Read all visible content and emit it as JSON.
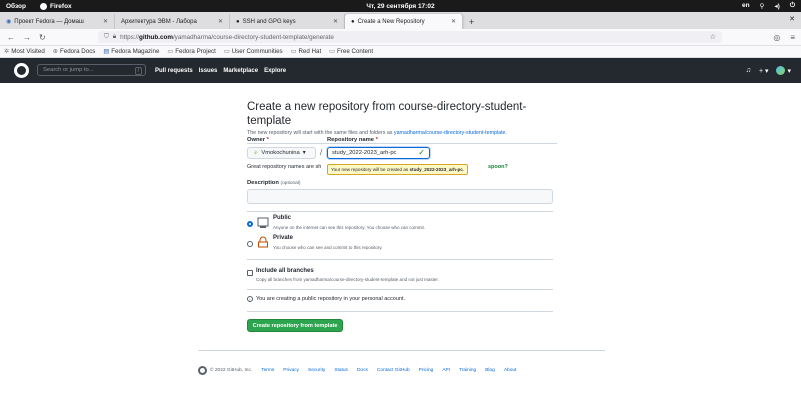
{
  "system_bar": {
    "overview": "Обзор",
    "app": "Firefox",
    "datetime": "Чт, 29 сентября 17:02",
    "lang": "en"
  },
  "tabs": [
    {
      "label": "Проект Fedora — Домаш"
    },
    {
      "label": "Архитектура ЭВМ - Лабора"
    },
    {
      "label": "SSH and GPG keys"
    },
    {
      "label": "Create a New Repository"
    }
  ],
  "nav": {
    "url_prefix": "https://",
    "url_domain": "github.com",
    "url_path": "/yamadharma/course-directory-student-template/generate"
  },
  "bookmarks": [
    "Most Visited",
    "Fedora Docs",
    "Fedora Magazine",
    "Fedora Project",
    "User Communities",
    "Red Hat",
    "Free Content"
  ],
  "github_header": {
    "search_placeholder": "Search or jump to...",
    "search_key": "/",
    "links": [
      "Pull requests",
      "Issues",
      "Marketplace",
      "Explore"
    ]
  },
  "form": {
    "title": "Create a new repository from course-directory-student-template",
    "subtitle_prefix": "The new repository will start with the same files and folders as",
    "subtitle_link": "yamadharma/course-directory-student-template",
    "owner_label": "Owner",
    "repo_label": "Repository name",
    "required_mark": "*",
    "owner_value": "Vmokochunina",
    "repo_value": "study_2022-2023_arh-pc",
    "great_text": "Great repository names are sh",
    "great_suggestion": "spoon?",
    "tooltip_prefix": "Your new repository will be created as",
    "tooltip_name": "study_2022-2023_arh-pc",
    "description_label": "Description",
    "description_optional": "(optional)",
    "public_title": "Public",
    "public_desc": "Anyone on the internet can see this repository. You choose who can commit.",
    "private_title": "Private",
    "private_desc": "You choose who can see and commit to this repository.",
    "include_title": "Include all branches",
    "include_desc": "Copy all branches from yamadharma/course-directory-student-template and not just master.",
    "info_text": "You are creating a public repository in your personal account.",
    "create_button": "Create repository from template",
    "selected_visibility": "Public"
  },
  "footer": {
    "copyright": "© 2022 GitHub, Inc.",
    "links": [
      "Terms",
      "Privacy",
      "Security",
      "Status",
      "Docs",
      "Contact GitHub",
      "Pricing",
      "API",
      "Training",
      "Blog",
      "About"
    ]
  }
}
